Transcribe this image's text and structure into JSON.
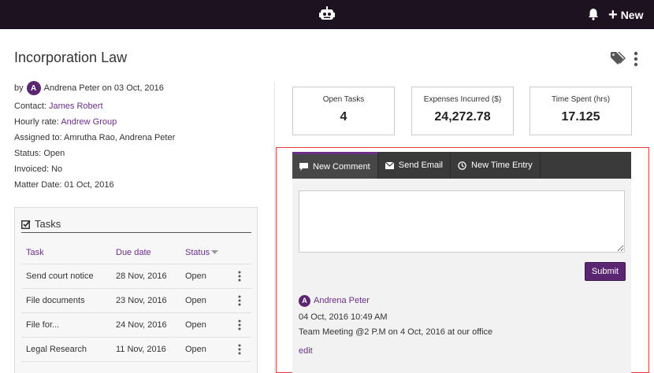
{
  "topbar": {
    "logo_icon": "robot-icon",
    "notification_icon": "bell-icon",
    "new_label": "New"
  },
  "matter": {
    "title": "Incorporation Law",
    "by_prefix": "by",
    "avatar_initial": "A",
    "author": "Andrena Peter",
    "created_text": "on 03 Oct, 2016",
    "contact_label": "Contact:",
    "contact_value": "James Robert",
    "hourly_rate_label": "Hourly rate:",
    "hourly_rate_value": "Andrew Group",
    "assigned_label": "Assigned to:",
    "assigned_value": "Amrutha Rao, Andrena Peter",
    "status_label": "Status:",
    "status_value": "Open",
    "invoiced_label": "Invoiced:",
    "invoiced_value": "No",
    "matter_date_label": "Matter Date:",
    "matter_date_value": "01 Oct, 2016"
  },
  "tasks": {
    "title": "Tasks",
    "columns": {
      "task": "Task",
      "due": "Due date",
      "status": "Status"
    },
    "rows": [
      {
        "task": "Send court notice",
        "due": "28 Nov, 2016",
        "status": "Open"
      },
      {
        "task": "File documents",
        "due": "23 Nov, 2016",
        "status": "Open"
      },
      {
        "task": "File for...",
        "due": "24 Nov, 2016",
        "status": "Open"
      },
      {
        "task": "Legal Research",
        "due": "11 Nov, 2016",
        "status": "Open"
      }
    ]
  },
  "stats": [
    {
      "label": "Open Tasks",
      "value": "4"
    },
    {
      "label": "Expenses Incurred ($)",
      "value": "24,272.78"
    },
    {
      "label": "Time Spent (hrs)",
      "value": "17.125"
    }
  ],
  "activity": {
    "tabs": [
      {
        "label": "New Comment",
        "icon": "comment-icon"
      },
      {
        "label": "Send Email",
        "icon": "envelope-icon"
      },
      {
        "label": "New Time Entry",
        "icon": "clock-icon"
      }
    ],
    "comment_value": "",
    "submit_label": "Submit",
    "entry": {
      "avatar_initial": "A",
      "author": "Andrena Peter",
      "timestamp": "04 Oct, 2016 10:49 AM",
      "text": "Team Meeting @2 P.M on 4 Oct, 2016 at our office",
      "edit_label": "edit"
    }
  },
  "colors": {
    "topbar": "#1c1220",
    "accent": "#6a2f86",
    "button": "#5b2671",
    "tab_bar": "#3a3a3a",
    "highlight": "#e23b3b"
  }
}
